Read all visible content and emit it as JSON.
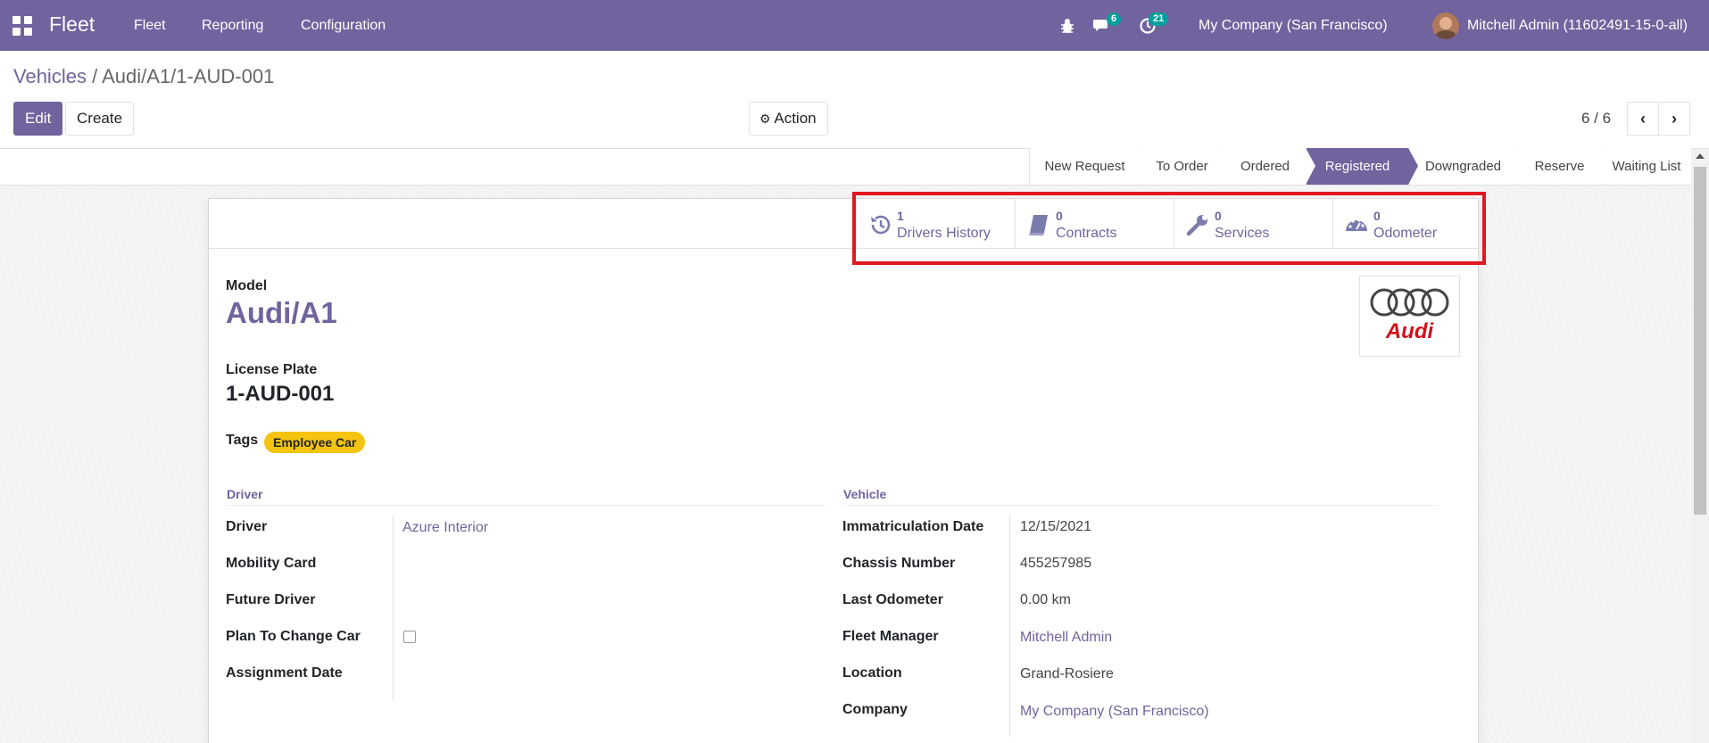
{
  "navbar": {
    "brand": "Fleet",
    "menu": [
      "Fleet",
      "Reporting",
      "Configuration"
    ],
    "messages_count": "6",
    "activities_count": "21",
    "company": "My Company (San Francisco)",
    "user": "Mitchell Admin (11602491-15-0-all)"
  },
  "breadcrumb": {
    "parent": "Vehicles",
    "separator": "/",
    "current": "Audi/A1/1-AUD-001"
  },
  "buttons": {
    "edit": "Edit",
    "create": "Create",
    "action": "Action"
  },
  "pager": {
    "value": "6 / 6"
  },
  "stages": [
    {
      "label": "New Request"
    },
    {
      "label": "To Order"
    },
    {
      "label": "Ordered"
    },
    {
      "label": "Registered"
    },
    {
      "label": "Downgraded"
    },
    {
      "label": "Reserve"
    },
    {
      "label": "Waiting List"
    }
  ],
  "active_stage": "Registered",
  "smart_buttons": [
    {
      "value": "1",
      "label": "Drivers History",
      "icon": "history-icon"
    },
    {
      "value": "0",
      "label": "Contracts",
      "icon": "book-icon"
    },
    {
      "value": "0",
      "label": "Services",
      "icon": "wrench-icon"
    },
    {
      "value": "0",
      "label": "Odometer",
      "icon": "tachometer-icon"
    }
  ],
  "form": {
    "model_label": "Model",
    "model_value": "Audi/A1",
    "plate_label": "License Plate",
    "plate_value": "1-AUD-001",
    "tags_label": "Tags",
    "tag": "Employee Car",
    "logo_text": "Audi",
    "driver_group": {
      "title": "Driver",
      "rows": [
        {
          "label": "Driver",
          "value": "Azure Interior"
        },
        {
          "label": "Mobility Card",
          "value": ""
        },
        {
          "label": "Future Driver",
          "value": ""
        },
        {
          "label": "Plan To Change Car",
          "value": ""
        },
        {
          "label": "Assignment Date",
          "value": ""
        }
      ]
    },
    "vehicle_group": {
      "title": "Vehicle",
      "rows": [
        {
          "label": "Immatriculation Date",
          "value": "12/15/2021"
        },
        {
          "label": "Chassis Number",
          "value": "455257985"
        },
        {
          "label": "Last Odometer",
          "value": "0.00 km"
        },
        {
          "label": "Fleet Manager",
          "value": "Mitchell Admin"
        },
        {
          "label": "Location",
          "value": "Grand-Rosiere"
        },
        {
          "label": "Company",
          "value": "My Company (San Francisco)"
        }
      ]
    }
  }
}
